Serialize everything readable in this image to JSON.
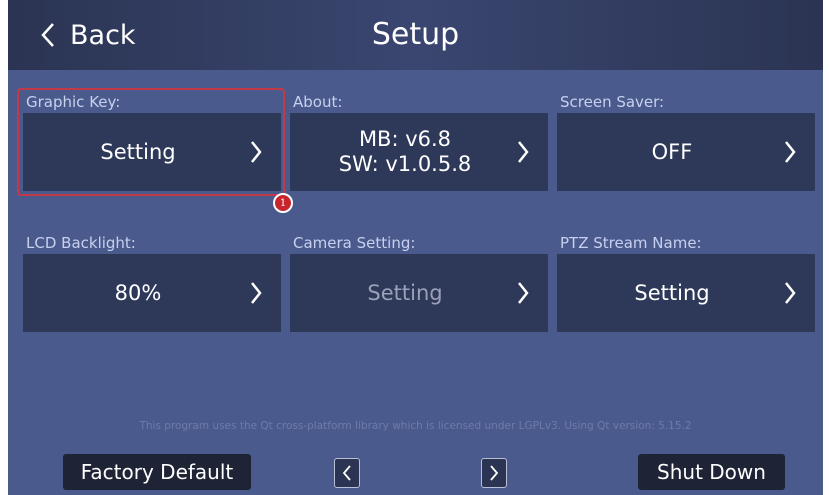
{
  "header": {
    "back_label": "Back",
    "title": "Setup"
  },
  "tiles": [
    {
      "label": "Graphic Key:",
      "value": "Setting"
    },
    {
      "label": "About:",
      "value_lines": [
        "MB: v6.8",
        "SW: v1.0.5.8"
      ]
    },
    {
      "label": "Screen Saver:",
      "value": "OFF"
    },
    {
      "label": "LCD Backlight:",
      "value": "80%"
    },
    {
      "label": "Camera Setting:",
      "value": "Setting"
    },
    {
      "label": "PTZ Stream Name:",
      "value": "Setting"
    }
  ],
  "annotation": {
    "marker": "1"
  },
  "license_text": "This program uses the Qt cross-platform library which is licensed under LGPLv3. Using Qt version: 5.15.2",
  "footer": {
    "factory_default_label": "Factory Default",
    "shut_down_label": "Shut Down"
  },
  "icons": {
    "back": "chevron-left-icon",
    "tile_arrow": "chevron-right-icon",
    "prev": "prev-page-icon",
    "next": "next-page-icon"
  },
  "colors": {
    "background": "#4a5a8c",
    "tile": "#2e3858",
    "header": "#2b3452",
    "highlight": "#c23a4a",
    "button": "#1e2335"
  }
}
